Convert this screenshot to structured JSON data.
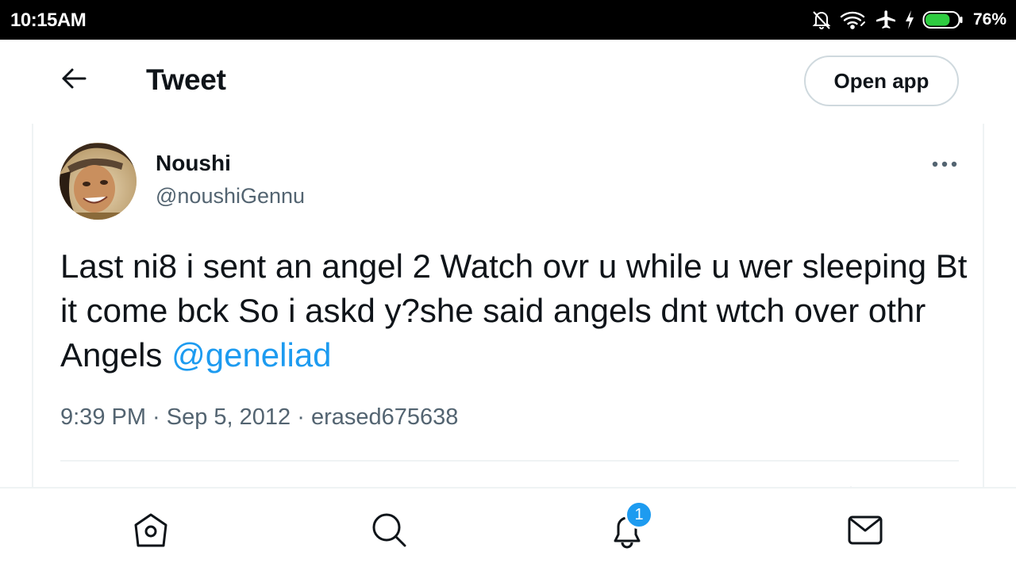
{
  "status_bar": {
    "time": "10:15AM",
    "battery_percent": "76%",
    "battery_level": 0.76,
    "icons": [
      "mute-bell-icon",
      "wifi-icon",
      "airplane-icon",
      "charging-bolt-icon",
      "battery-icon"
    ],
    "battery_color": "#2ecc40"
  },
  "header": {
    "title": "Tweet",
    "open_app_label": "Open app",
    "back_icon": "arrow-left-icon"
  },
  "tweet": {
    "author_name": "Noushi",
    "author_handle": "@noushiGennu",
    "text": "Last ni8 i sent an angel 2 Watch ovr u while u wer sleeping Bt it come bck So i askd y?she said angels dnt wtch over othr Angels ",
    "mention": "@geneliad",
    "meta": "9:39 PM · Sep 5, 2012 · erased675638",
    "more_icon": "more-horizontal-icon"
  },
  "bottom_nav": {
    "items": [
      "home-icon",
      "search-icon",
      "notifications-icon",
      "messages-icon"
    ],
    "notification_count": "1"
  },
  "colors": {
    "accent": "#1d9bf0",
    "text_primary": "#0f1419",
    "text_secondary": "#536471",
    "border": "#eff3f4"
  }
}
